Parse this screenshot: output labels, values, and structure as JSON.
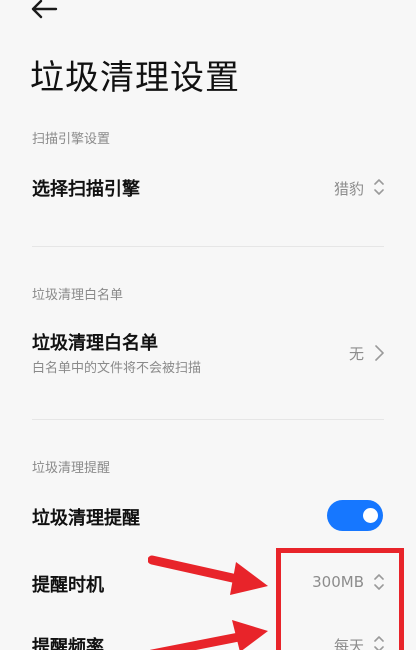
{
  "header": {
    "title": "垃圾清理设置"
  },
  "sections": [
    {
      "header": "扫描引擎设置",
      "rows": [
        {
          "title": "选择扫描引擎",
          "value": "猎豹"
        }
      ]
    },
    {
      "header": "垃圾清理白名单",
      "rows": [
        {
          "title": "垃圾清理白名单",
          "subtitle": "白名单中的文件将不会被扫描",
          "value": "无"
        }
      ]
    },
    {
      "header": "垃圾清理提醒",
      "rows": [
        {
          "title": "垃圾清理提醒",
          "toggle_on": true
        },
        {
          "title": "提醒时机",
          "value": "300MB"
        },
        {
          "title": "提醒频率",
          "value": "每天"
        }
      ]
    }
  ],
  "colors": {
    "accent": "#1677ff",
    "annotation": "#e8242a"
  },
  "icons": {
    "back": "arrow-left-icon",
    "chevron": "chevron-right-icon",
    "selector": "chevron-up-down-icon"
  }
}
